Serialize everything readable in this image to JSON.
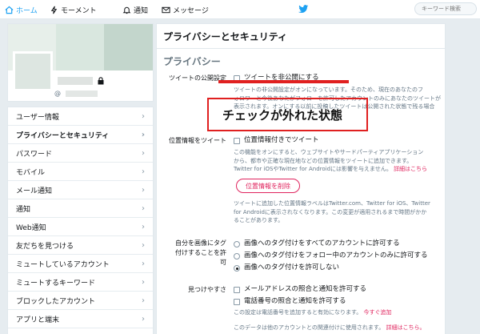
{
  "topbar": {
    "home": "ホーム",
    "moments": "モーメント",
    "notifications": "通知",
    "messages": "メッセージ",
    "search_placeholder": "キーワード検索"
  },
  "profile": {
    "handle_prefix": "@"
  },
  "sidebar": {
    "items": [
      {
        "label": "ユーザー情報"
      },
      {
        "label": "プライバシーとセキュリティ"
      },
      {
        "label": "パスワード"
      },
      {
        "label": "モバイル"
      },
      {
        "label": "メール通知"
      },
      {
        "label": "通知"
      },
      {
        "label": "Web通知"
      },
      {
        "label": "友だちを見つける"
      },
      {
        "label": "ミュートしているアカウント"
      },
      {
        "label": "ミュートするキーワード"
      },
      {
        "label": "ブロックしたアカウント"
      },
      {
        "label": "アプリと端末"
      }
    ],
    "chevron": "›"
  },
  "main": {
    "page_title": "プライバシーとセキュリティ",
    "section_title": "プライバシー",
    "tweet_privacy": {
      "label": "ツイートの公開設定",
      "checkbox": "ツイートを非公開にする",
      "help_1": "ツイートの非公開設定がオンになっています。そのため、現在のあなたのフ",
      "help_2": "ォロワーと今後あなたがフォローを許可したアカウントのみにあなたのツイートが",
      "help_3": "表示されます。オンにする以前に投稿したツイートは公開された状態で残る場合"
    },
    "location": {
      "label": "位置情報をツイート",
      "checkbox": "位置情報付きでツイート",
      "help_1": "この機能をオンにすると、ウェブサイトやサードパーティアプリケーション",
      "help_2": "から、都市や正確な現在地などの位置情報をツイートに追加できます。",
      "help_3": "Twitter for iOSやTwitter for Androidには影響を与えません。",
      "help_link": "詳細はこちら",
      "delete_button": "位置情報を削除",
      "note_1": "ツイートに追加した位置情報ラベルはTwitter.com、Twitter for iOS、Twitter",
      "note_2": "for Androidに表示されなくなります。この変更が適用されるまで時間がかか",
      "note_3": "ることがあります。"
    },
    "photo_tagging": {
      "label_1": "自分を画像にタグ",
      "label_2": "付けすることを許",
      "label_3": "可",
      "opt_all": "画像へのタグ付けをすべてのアカウントに許可する",
      "opt_following": "画像へのタグ付けをフォロー中のアカウントのみに許可する",
      "opt_none": "画像へのタグ付けを許可しない",
      "selected": "opt_none"
    },
    "discoverability": {
      "label": "見つけやすさ",
      "email_checkbox": "メールアドレスの照合と通知を許可する",
      "phone_checkbox": "電話番号の照合と通知を許可する",
      "phone_help": "この設定は電話番号を追加すると有効になります。",
      "phone_link": "今すぐ追加",
      "data_help": "このデータは他のアカウントとの関連付けに使用されます。",
      "data_link": "詳細はこちら。"
    }
  },
  "annotation": {
    "text": "チェックが外れた状態",
    "color": "#e02020"
  },
  "colors": {
    "accent": "#1da1f2",
    "link": "#e0245e"
  }
}
